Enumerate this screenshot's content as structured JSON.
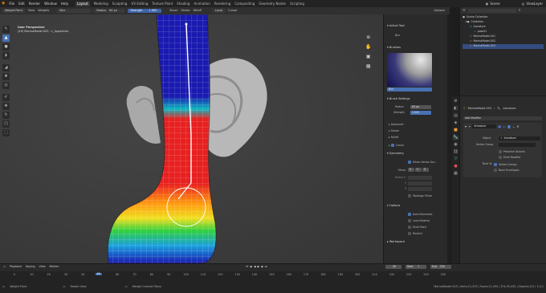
{
  "menu": {
    "items": [
      "File",
      "Edit",
      "Render",
      "Window",
      "Help"
    ]
  },
  "workspaces": {
    "items": [
      "Layout",
      "Modeling",
      "Sculpting",
      "UV Editing",
      "Texture Paint",
      "Shading",
      "Animation",
      "Rendering",
      "Compositing",
      "Geometry Nodes",
      "Scripting"
    ],
    "active": "Layout"
  },
  "top_right": {
    "scene": "Scene",
    "view_layer": "ViewLayer"
  },
  "tool_header": {
    "mode": "Weight Paint",
    "view": "View",
    "weights": "Weights",
    "brush": "Blur",
    "radius_label": "Radius",
    "radius_value": "64 px",
    "strength_label": "Strength",
    "strength_value": "1.000",
    "brush_menu": "Brush",
    "stroke_menu": "Stroke",
    "falloff_menu": "Falloff",
    "transform": "Local",
    "cursor": "Cursor",
    "options": "Options"
  },
  "viewport": {
    "perspective": "User Perspective",
    "object": "(49) MarinaModel.003 : L_UpperArm"
  },
  "tool_panel": {
    "active_tool": "Active Tool",
    "blur_label": "Blur",
    "brushes": "Brushes",
    "brush_name": "Blur",
    "brush_settings": "Brush Settings",
    "radius_label": "Radius",
    "radius_value": "64 px",
    "strength_label": "Strength",
    "strength_value": "1.000",
    "advanced": "Advanced",
    "stroke": "Stroke",
    "falloff": "Falloff",
    "cursor": "Cursor",
    "symmetry": "Symmetry",
    "mirror_vg": "Mirror Vertex Gro...",
    "mirror": "Mirror",
    "radial_x": "Radial X",
    "radial_y": "Y",
    "radial_z": "Z",
    "topology_mirror": "Topology Mirror",
    "options": "Options",
    "auto_normalize": "Auto Normalize",
    "lock_relative": "Lock-Relative",
    "multi_paint": "Multi-Paint",
    "restrict": "Restrict",
    "workspace": "Workspace"
  },
  "outliner": {
    "title": "Scene Collection",
    "items": [
      "Collection",
      "Armature",
      "pose01",
      "MarinaModel.001",
      "MarinaModel.002",
      "MarinaModel.003"
    ]
  },
  "properties": {
    "breadcrumb_obj": "MarinaModel.003",
    "breadcrumb_mod": "Armature",
    "add_modifier": "Add Modifier",
    "mod_name": "Armature",
    "object_label": "Object",
    "object_value": "Armature",
    "vgroup_label": "Vertex Group",
    "preserve_volume": "Preserve Volume",
    "multi_modifier": "Multi Modifier",
    "bind_to": "Bind To",
    "vertex_groups": "Vertex Groups",
    "bone_envelopes": "Bone Envelopes"
  },
  "timeline": {
    "playback": "Playback",
    "keying": "Keying",
    "view": "View",
    "marker": "Marker",
    "current_frame": "49",
    "start_label": "Start",
    "start": "1",
    "end_label": "End",
    "end": "250",
    "ticks": [
      "0",
      "10",
      "20",
      "30",
      "40",
      "50",
      "60",
      "70",
      "80",
      "90",
      "100",
      "110",
      "120",
      "130",
      "140",
      "150",
      "160",
      "170",
      "180",
      "190",
      "200",
      "210",
      "220",
      "230",
      "240",
      "250"
    ]
  },
  "statusbar": {
    "left": "Weight Paint",
    "middle": "Rotate View",
    "right_hint": "Weight Context Menu",
    "stats": "MarinaModel.003 | Verts:21,393 | Faces:21,094 | Tris:39,430 | Objects:1/3 | 3.4.1"
  },
  "colors": {
    "accent": "#4772b3",
    "bg": "#3d3d3d",
    "panel": "#2a2a2a"
  }
}
